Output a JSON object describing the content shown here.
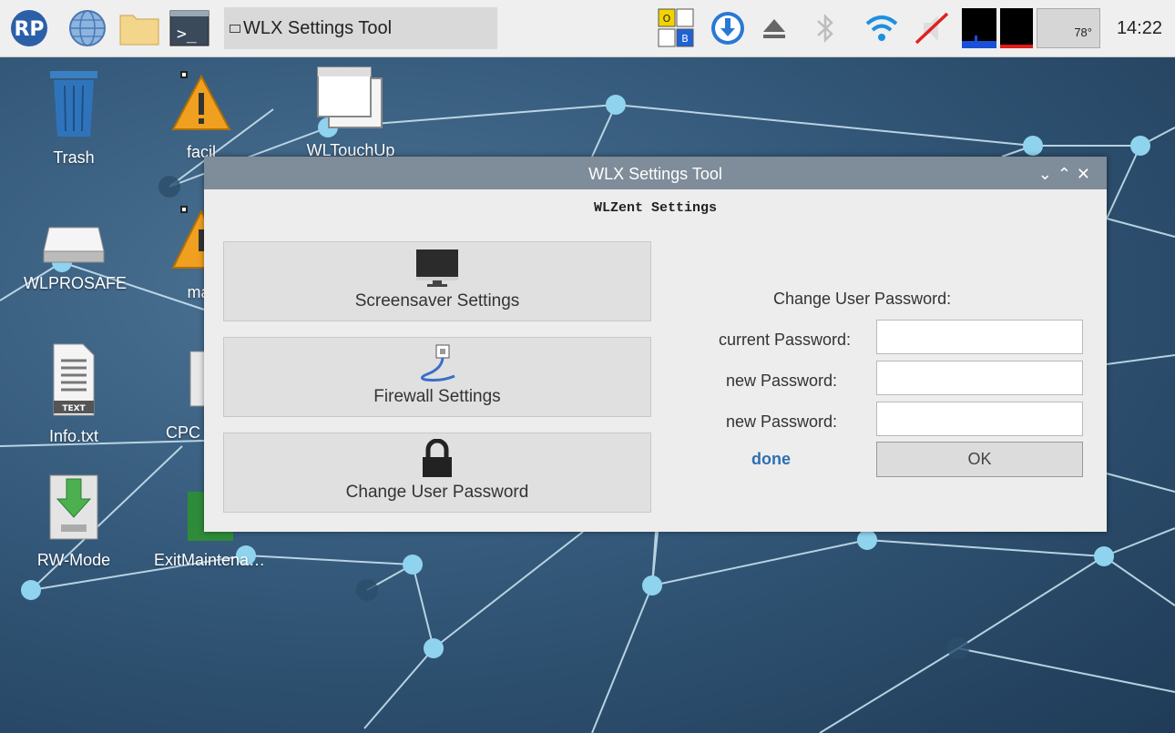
{
  "taskbar": {
    "task_title": "WLX Settings Tool",
    "indicator_o": "O",
    "indicator_b": "B",
    "temperature": "78°",
    "clock": "14:22"
  },
  "desktop": {
    "icons": [
      {
        "label": "Trash",
        "icon": "trash-icon"
      },
      {
        "label": "facil",
        "icon": "warning-icon"
      },
      {
        "label": "WLTouchUp",
        "icon": "window-icon"
      },
      {
        "label": "WLPROSAFE",
        "icon": "drive-icon"
      },
      {
        "label": "mar",
        "icon": "warning-icon"
      },
      {
        "label": "Info.txt",
        "icon": "text-file-icon"
      },
      {
        "label": "CPC",
        "icon": "computer-icon"
      },
      {
        "label": "RW-Mode",
        "icon": "install-icon"
      },
      {
        "label": "ExitMaintena…",
        "icon": "exit-icon"
      }
    ],
    "file_badge": "TEXT"
  },
  "window": {
    "title": "WLX Settings Tool",
    "controls": [
      "⌄",
      "⌃",
      "✕"
    ],
    "heading": "WLZent Settings",
    "buttons": [
      {
        "label": "Screensaver Settings",
        "icon": "monitor-icon"
      },
      {
        "label": "Firewall Settings",
        "icon": "network-cable-icon"
      },
      {
        "label": "Change User Password",
        "icon": "lock-icon"
      }
    ],
    "password": {
      "title": "Change User Password:",
      "current_label": "current Password:",
      "new_label": "new Password:",
      "confirm_label": "new Password:",
      "current_value": "",
      "new_value": "",
      "confirm_value": "",
      "done_label": "done",
      "ok_label": "OK"
    }
  },
  "colors": {
    "taskbar_bg": "#efefef",
    "titlebar_bg": "#7f8c99",
    "window_bg": "#ededed",
    "accent": "#2d6fb3",
    "node": "#8fd3ee"
  }
}
